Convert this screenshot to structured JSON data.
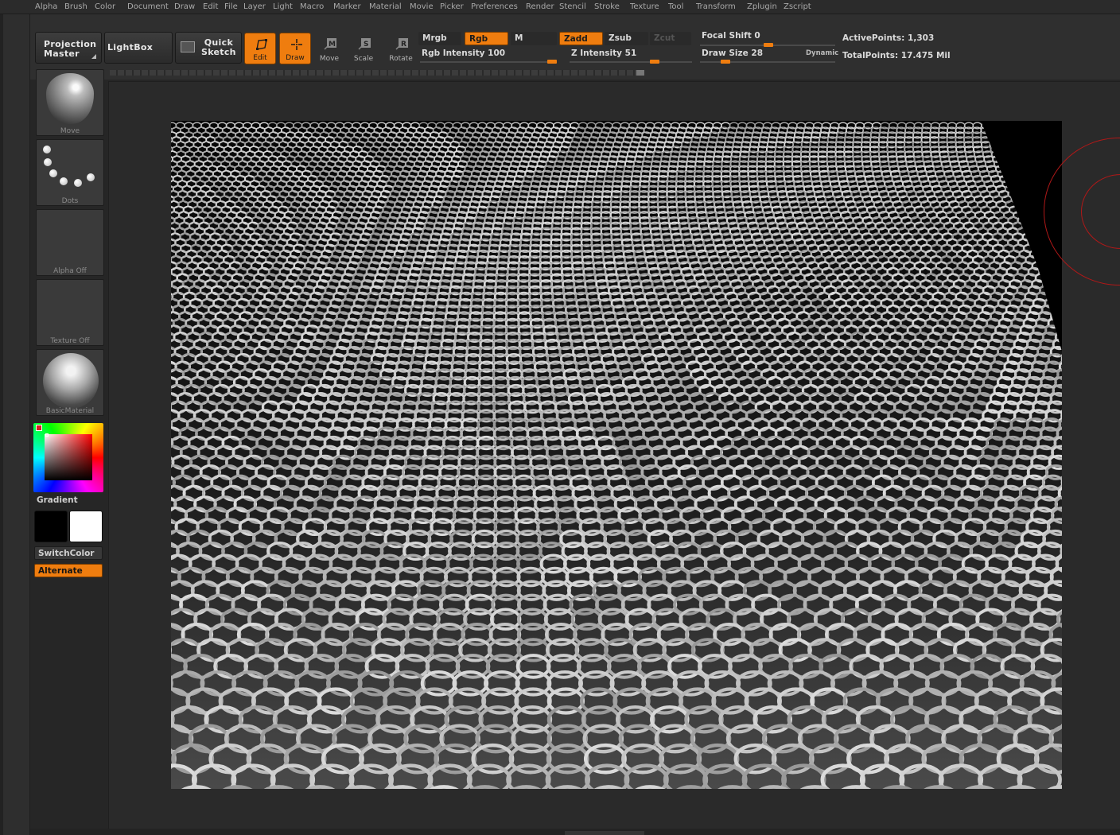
{
  "menu": [
    "Alpha",
    "Brush",
    "Color",
    "Document",
    "Draw",
    "Edit",
    "File",
    "Layer",
    "Light",
    "Macro",
    "Marker",
    "Material",
    "Movie",
    "Picker",
    "Preferences",
    "Render",
    "Stencil",
    "Stroke",
    "Texture",
    "Tool",
    "Transform",
    "Zplugin",
    "Zscript"
  ],
  "toolbar": {
    "projection_master": "Projection\nMaster",
    "lightbox": "LightBox",
    "quick_sketch": "Quick\nSketch",
    "edit": "Edit",
    "draw": "Draw",
    "move": "Move",
    "scale": "Scale",
    "rotate": "Rotate"
  },
  "modes": {
    "mrgb": "Mrgb",
    "rgb": "Rgb",
    "m": "M",
    "zadd": "Zadd",
    "zsub": "Zsub",
    "zcut": "Zcut"
  },
  "sliders": {
    "rgb_intensity_label": "Rgb Intensity",
    "rgb_intensity_value": "100",
    "z_intensity_label": "Z Intensity",
    "z_intensity_value": "51",
    "focal_shift_label": "Focal Shift",
    "focal_shift_value": "0",
    "draw_size_label": "Draw Size",
    "draw_size_value": "28",
    "dynamic": "Dynamic"
  },
  "stats": {
    "active_points": "ActivePoints: 1,303",
    "total_points": "TotalPoints: 17.475 Mil"
  },
  "palette": {
    "brush": "Move",
    "stroke": "Dots",
    "alpha": "Alpha Off",
    "texture": "Texture Off",
    "material": "BasicMaterial",
    "gradient": "Gradient",
    "switch_color": "SwitchColor",
    "alternate": "Alternate"
  },
  "colors": {
    "accent": "#ef7d0f",
    "main_color": "#000000",
    "secondary_color": "#ffffff"
  }
}
